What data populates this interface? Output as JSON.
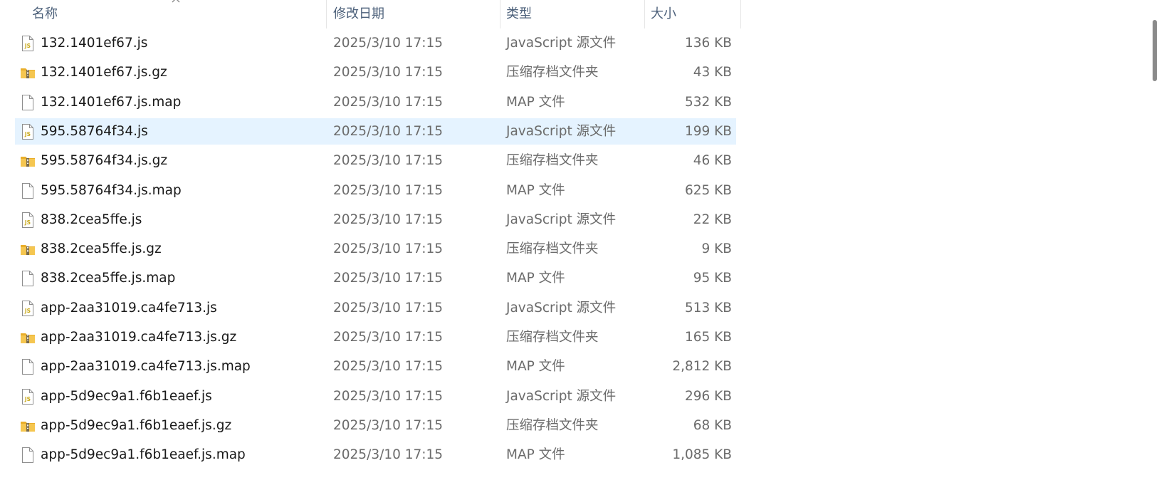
{
  "header": {
    "name": "名称",
    "date_modified": "修改日期",
    "type": "类型",
    "size": "大小"
  },
  "colors": {
    "selected_row": "#e5f3ff",
    "header_text": "#4c607a",
    "js_icon": "#c8a818",
    "zip_folder": "#f2c14a"
  },
  "files": [
    {
      "name": "132.1401ef67.js",
      "date": "2025/3/10 17:15",
      "type": "JavaScript 源文件",
      "size": "136 KB",
      "icon": "js-file-icon"
    },
    {
      "name": "132.1401ef67.js.gz",
      "date": "2025/3/10 17:15",
      "type": "压缩存档文件夹",
      "size": "43 KB",
      "icon": "zip-folder-icon"
    },
    {
      "name": "132.1401ef67.js.map",
      "date": "2025/3/10 17:15",
      "type": "MAP 文件",
      "size": "532 KB",
      "icon": "blank-file-icon"
    },
    {
      "name": "595.58764f34.js",
      "date": "2025/3/10 17:15",
      "type": "JavaScript 源文件",
      "size": "199 KB",
      "icon": "js-file-icon",
      "selected": true
    },
    {
      "name": "595.58764f34.js.gz",
      "date": "2025/3/10 17:15",
      "type": "压缩存档文件夹",
      "size": "46 KB",
      "icon": "zip-folder-icon"
    },
    {
      "name": "595.58764f34.js.map",
      "date": "2025/3/10 17:15",
      "type": "MAP 文件",
      "size": "625 KB",
      "icon": "blank-file-icon"
    },
    {
      "name": "838.2cea5ffe.js",
      "date": "2025/3/10 17:15",
      "type": "JavaScript 源文件",
      "size": "22 KB",
      "icon": "js-file-icon"
    },
    {
      "name": "838.2cea5ffe.js.gz",
      "date": "2025/3/10 17:15",
      "type": "压缩存档文件夹",
      "size": "9 KB",
      "icon": "zip-folder-icon"
    },
    {
      "name": "838.2cea5ffe.js.map",
      "date": "2025/3/10 17:15",
      "type": "MAP 文件",
      "size": "95 KB",
      "icon": "blank-file-icon"
    },
    {
      "name": "app-2aa31019.ca4fe713.js",
      "date": "2025/3/10 17:15",
      "type": "JavaScript 源文件",
      "size": "513 KB",
      "icon": "js-file-icon"
    },
    {
      "name": "app-2aa31019.ca4fe713.js.gz",
      "date": "2025/3/10 17:15",
      "type": "压缩存档文件夹",
      "size": "165 KB",
      "icon": "zip-folder-icon"
    },
    {
      "name": "app-2aa31019.ca4fe713.js.map",
      "date": "2025/3/10 17:15",
      "type": "MAP 文件",
      "size": "2,812 KB",
      "icon": "blank-file-icon"
    },
    {
      "name": "app-5d9ec9a1.f6b1eaef.js",
      "date": "2025/3/10 17:15",
      "type": "JavaScript 源文件",
      "size": "296 KB",
      "icon": "js-file-icon"
    },
    {
      "name": "app-5d9ec9a1.f6b1eaef.js.gz",
      "date": "2025/3/10 17:15",
      "type": "压缩存档文件夹",
      "size": "68 KB",
      "icon": "zip-folder-icon"
    },
    {
      "name": "app-5d9ec9a1.f6b1eaef.js.map",
      "date": "2025/3/10 17:15",
      "type": "MAP 文件",
      "size": "1,085 KB",
      "icon": "blank-file-icon"
    }
  ]
}
